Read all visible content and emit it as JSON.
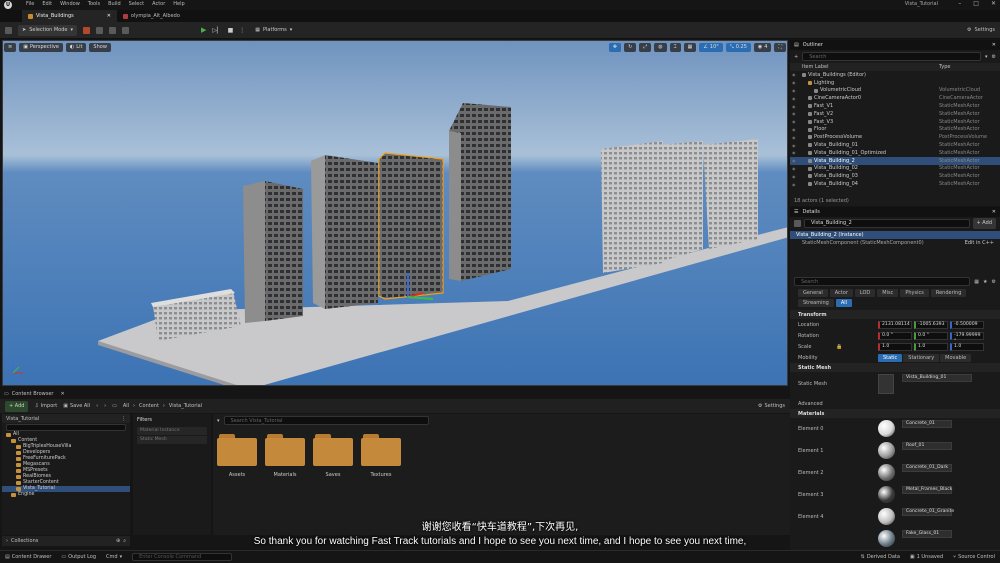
{
  "menubar": {
    "logo": "U",
    "items": [
      "File",
      "Edit",
      "Window",
      "Tools",
      "Build",
      "Select",
      "Actor",
      "Help"
    ],
    "project": "Vista_Tutorial"
  },
  "tabs": [
    {
      "label": "Vista_Buildings"
    },
    {
      "label": "olympia_Alt_Albedo"
    }
  ],
  "toolbar": {
    "mode": "Selection Mode",
    "platforms": "Platforms",
    "settings": "Settings"
  },
  "viewport": {
    "perspective": "Perspective",
    "lit": "Lit",
    "show": "Show",
    "snap_angle": "10°",
    "snap_scale": "0.25",
    "cam_speed": "4"
  },
  "outliner": {
    "title": "Outliner",
    "search_placeholder": "Search",
    "col_label": "Item Label",
    "col_type": "Type",
    "rows": [
      {
        "label": "Vista_Buildings (Editor)",
        "type": "",
        "indent": 1,
        "kind": "world"
      },
      {
        "label": "Lighting",
        "type": "",
        "indent": 2,
        "kind": "folder"
      },
      {
        "label": "VolumetricCloud",
        "type": "VolumetricCloud",
        "indent": 3,
        "kind": "actor"
      },
      {
        "label": "CineCameraActor0",
        "type": "CineCameraActor",
        "indent": 2,
        "kind": "actor"
      },
      {
        "label": "Fast_V1",
        "type": "StaticMeshActor",
        "indent": 2,
        "kind": "actor"
      },
      {
        "label": "Fast_V2",
        "type": "StaticMeshActor",
        "indent": 2,
        "kind": "actor"
      },
      {
        "label": "Fast_V3",
        "type": "StaticMeshActor",
        "indent": 2,
        "kind": "actor"
      },
      {
        "label": "Floor",
        "type": "StaticMeshActor",
        "indent": 2,
        "kind": "actor"
      },
      {
        "label": "PostProcessVolume",
        "type": "PostProcessVolume",
        "indent": 2,
        "kind": "actor"
      },
      {
        "label": "Vista_Building_01",
        "type": "StaticMeshActor",
        "indent": 2,
        "kind": "actor"
      },
      {
        "label": "Vista_Building_01_Optimized",
        "type": "StaticMeshActor",
        "indent": 2,
        "kind": "actor"
      },
      {
        "label": "Vista_Building_2",
        "type": "StaticMeshActor",
        "indent": 2,
        "kind": "actor",
        "selected": true
      },
      {
        "label": "Vista_Building_02",
        "type": "StaticMeshActor",
        "indent": 2,
        "kind": "actor"
      },
      {
        "label": "Vista_Building_03",
        "type": "StaticMeshActor",
        "indent": 2,
        "kind": "actor"
      },
      {
        "label": "Vista_Building_04",
        "type": "StaticMeshActor",
        "indent": 2,
        "kind": "actor"
      }
    ],
    "count": "18 actors (1 selected)"
  },
  "details": {
    "title": "Details",
    "actor_name": "Vista_Building_2",
    "add_label": "+ Add",
    "instance": "Vista_Building_2 (Instance)",
    "component": "StaticMeshComponent (StaticMeshComponent0)",
    "edit_cpp": "Edit in C++",
    "search_placeholder": "Search",
    "filters": [
      "General",
      "Actor",
      "LOD",
      "Misc",
      "Physics",
      "Rendering",
      "Streaming",
      "All"
    ],
    "transform_label": "Transform",
    "location_label": "Location",
    "location": [
      "2131.08114",
      "-1005.6393",
      "-0.500009"
    ],
    "rotation_label": "Rotation",
    "rotation": [
      "0.0 °",
      "0.0 °",
      "-179.99999 °"
    ],
    "scale_label": "Scale",
    "scale": [
      "1.0",
      "1.0",
      "1.0"
    ],
    "mobility_label": "Mobility",
    "mobility": [
      "Static",
      "Stationary",
      "Movable"
    ],
    "static_mesh_cat": "Static Mesh",
    "static_mesh_label": "Static Mesh",
    "static_mesh_value": "Vista_Building_01",
    "advanced": "Advanced",
    "materials_cat": "Materials",
    "materials": [
      {
        "element": "Element 0",
        "material": "Concrete_01",
        "color": "#d8d8d8"
      },
      {
        "element": "Element 1",
        "material": "Roof_01",
        "color": "#9a9a9a"
      },
      {
        "element": "Element 2",
        "material": "Concrete_01_Dark",
        "color": "#6f6f6f"
      },
      {
        "element": "Element 3",
        "material": "Metal_Frames_Black",
        "color": "#3a3a3a"
      },
      {
        "element": "Element 4",
        "material": "Concrete_01_Granite",
        "color": "#bdbdbd"
      },
      {
        "element": "",
        "material": "Fake_Glass_01",
        "color": "#6a7a88"
      }
    ]
  },
  "content_browser": {
    "tab": "Content Browser",
    "add": "+ Add",
    "import": "Import",
    "save_all": "Save All",
    "path": [
      "All",
      "Content",
      "Vista_Tutorial"
    ],
    "settings": "Settings",
    "tree_root": "Vista_Tutorial",
    "tree": [
      {
        "label": "All",
        "indent": 0
      },
      {
        "label": "Content",
        "indent": 1
      },
      {
        "label": "BigTriplexHouseVilla",
        "indent": 2
      },
      {
        "label": "Developers",
        "indent": 2
      },
      {
        "label": "FreeFurniturePack",
        "indent": 2
      },
      {
        "label": "Megascans",
        "indent": 2
      },
      {
        "label": "MSPresets",
        "indent": 2
      },
      {
        "label": "RealBiomes",
        "indent": 2
      },
      {
        "label": "StarterContent",
        "indent": 2
      },
      {
        "label": "Vista_Tutorial",
        "indent": 2,
        "selected": true
      },
      {
        "label": "Engine",
        "indent": 1
      }
    ],
    "filters_title": "Filters",
    "filter_items": [
      "Material Instance",
      "Static Mesh"
    ],
    "search_placeholder": "Search Vista_Tutorial",
    "folders": [
      "Assets",
      "Materials",
      "Saves",
      "Textures"
    ],
    "collections": "Collections"
  },
  "statusbar": {
    "content_drawer": "Content Drawer",
    "output_log": "Output Log",
    "cmd": "Cmd",
    "console_placeholder": "Enter Console Command",
    "derived_data": "Derived Data",
    "unsaved": "1 Unsaved",
    "source_control": "Source Control"
  },
  "subtitles": {
    "chinese": "谢谢您收看“快车道教程”,下次再见,",
    "english": "So thank you for watching Fast Track tutorials and I hope to see you next time, and I hope to see you next time,"
  }
}
